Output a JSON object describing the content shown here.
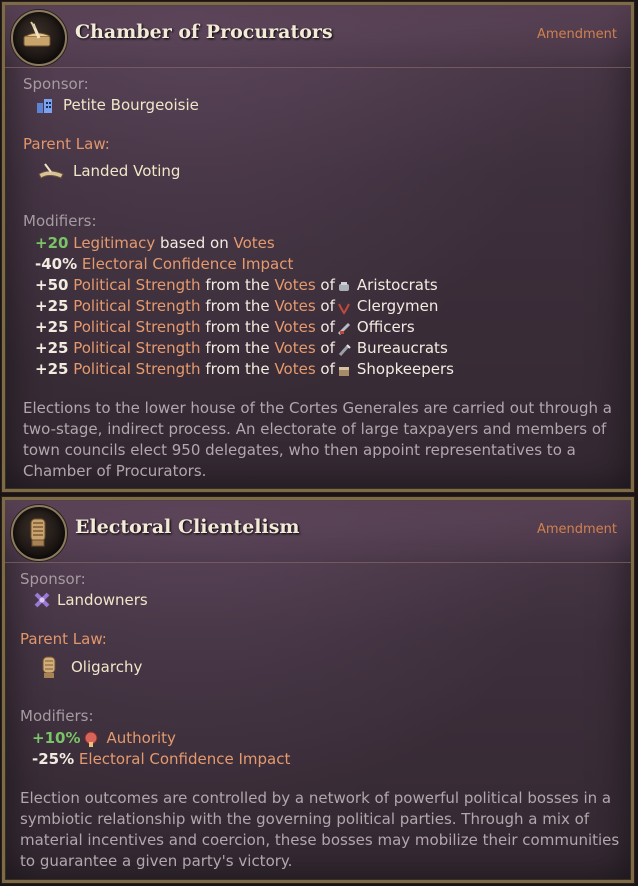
{
  "panel1": {
    "title": "Chamber of Procurators",
    "tag": "Amendment",
    "emblem_icon": "scroll-quill-icon",
    "sponsor_label": "Sponsor:",
    "sponsor": "Petite Bourgeoisie",
    "sponsor_icon": "petite-bourgeoisie-icon",
    "parent_law_label": "Parent Law:",
    "parent_law": "Landed Voting",
    "parent_law_icon": "landed-voting-icon",
    "modifiers_label": "Modifiers:",
    "modifiers": [
      {
        "value": "+20",
        "target": "Legitimacy",
        "mid": "based on",
        "source": "Votes"
      },
      {
        "value": "-40%",
        "text": "Electoral Confidence Impact"
      },
      {
        "value": "+50",
        "target": "Political Strength",
        "mid": "from the",
        "source": "Votes",
        "of": "of",
        "group": "Aristocrats",
        "group_icon": "aristocrats-icon"
      },
      {
        "value": "+25",
        "target": "Political Strength",
        "mid": "from the",
        "source": "Votes",
        "of": "of",
        "group": "Clergymen",
        "group_icon": "clergymen-icon"
      },
      {
        "value": "+25",
        "target": "Political Strength",
        "mid": "from the",
        "source": "Votes",
        "of": "of",
        "group": "Officers",
        "group_icon": "officers-icon"
      },
      {
        "value": "+25",
        "target": "Political Strength",
        "mid": "from the",
        "source": "Votes",
        "of": "of",
        "group": "Bureaucrats",
        "group_icon": "bureaucrats-icon"
      },
      {
        "value": "+25",
        "target": "Political Strength",
        "mid": "from the",
        "source": "Votes",
        "of": "of",
        "group": "Shopkeepers",
        "group_icon": "shopkeepers-icon"
      }
    ],
    "description": "Elections to the lower house of the Cortes Generales are carried out through a two-stage, indirect process. An electorate of large taxpayers and members of town councils elect 950 delegates, who then appoint representatives to a Chamber of Procurators."
  },
  "panel2": {
    "title": "Electoral Clientelism",
    "tag": "Amendment",
    "emblem_icon": "gauntlet-icon",
    "sponsor_label": "Sponsor:",
    "sponsor": "Landowners",
    "sponsor_icon": "landowners-icon",
    "parent_law_label": "Parent Law:",
    "parent_law": "Oligarchy",
    "parent_law_icon": "oligarchy-icon",
    "modifiers_label": "Modifiers:",
    "modifiers": [
      {
        "value": "+10%",
        "target": "Authority",
        "target_icon": "authority-icon"
      },
      {
        "value": "-25%",
        "text": "Electoral Confidence Impact"
      }
    ],
    "description": "Election outcomes are controlled by a network of powerful political bosses in a symbiotic relationship with the governing political parties. Through a mix of material incentives and coercion, these bosses may mobilize their communities to guarantee a given party's victory."
  },
  "colors": {
    "positive": "#79c466",
    "keyword": "#e59a6e",
    "tag": "#d0814e",
    "frame": "#7d6a47"
  }
}
